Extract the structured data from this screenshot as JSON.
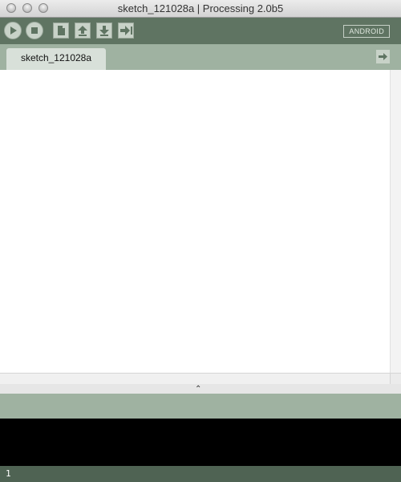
{
  "window": {
    "title": "sketch_121028a | Processing 2.0b5"
  },
  "toolbar": {
    "run_icon": "play-icon",
    "stop_icon": "stop-icon",
    "new_icon": "new-file-icon",
    "open_icon": "upload-arrow-icon",
    "save_icon": "download-arrow-icon",
    "export_icon": "export-arrow-icon",
    "mode_label": "ANDROID"
  },
  "tabs": [
    {
      "label": "sketch_121028a"
    }
  ],
  "tab_menu_icon": "arrow-right-icon",
  "editor": {
    "text": ""
  },
  "divider_icon": "caret-up-icon",
  "status": {
    "line_number": "1"
  },
  "colors": {
    "toolbar": "#5f7462",
    "tabstrip": "#9fb2a1",
    "status": "#4f6353",
    "console": "#000000"
  }
}
